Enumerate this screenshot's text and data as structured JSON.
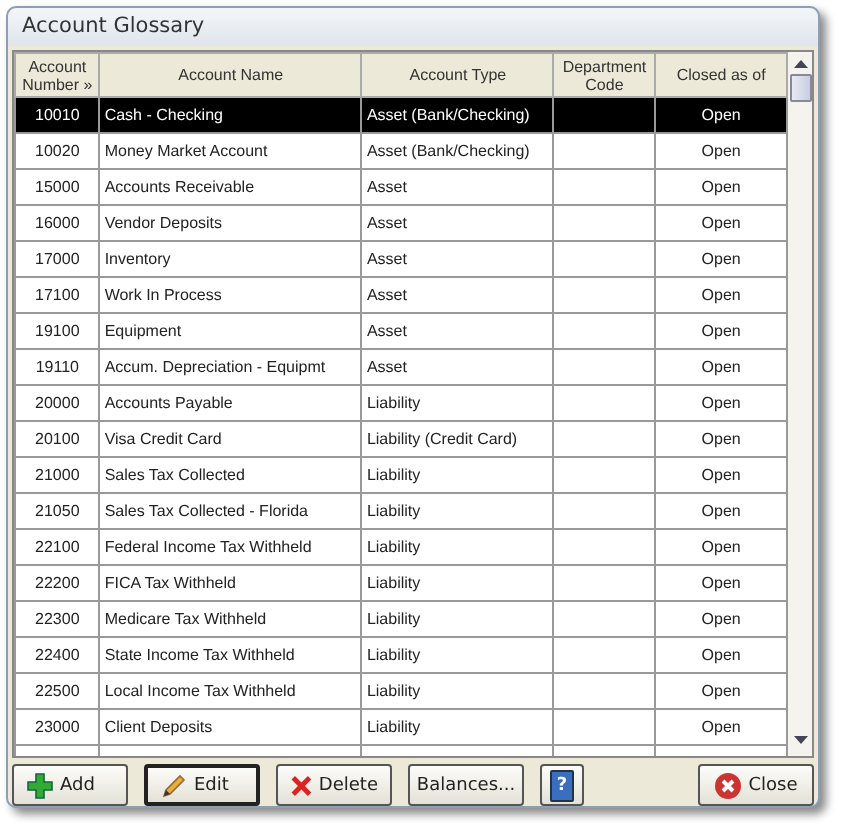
{
  "window": {
    "title": "Account Glossary"
  },
  "table": {
    "columns": [
      "Account Number »",
      "Account Name",
      "Account Type",
      "Department Code",
      "Closed as of"
    ],
    "rows": [
      {
        "cells": [
          "10010",
          "Cash - Checking",
          "Asset (Bank/Checking)",
          "",
          "Open"
        ],
        "selected": true
      },
      {
        "cells": [
          "10020",
          "Money Market Account",
          "Asset (Bank/Checking)",
          "",
          "Open"
        ],
        "selected": false
      },
      {
        "cells": [
          "15000",
          "Accounts Receivable",
          "Asset",
          "",
          "Open"
        ],
        "selected": false
      },
      {
        "cells": [
          "16000",
          "Vendor Deposits",
          "Asset",
          "",
          "Open"
        ],
        "selected": false
      },
      {
        "cells": [
          "17000",
          "Inventory",
          "Asset",
          "",
          "Open"
        ],
        "selected": false
      },
      {
        "cells": [
          "17100",
          "Work In Process",
          "Asset",
          "",
          "Open"
        ],
        "selected": false
      },
      {
        "cells": [
          "19100",
          "Equipment",
          "Asset",
          "",
          "Open"
        ],
        "selected": false
      },
      {
        "cells": [
          "19110",
          "Accum. Depreciation - Equipmt",
          "Asset",
          "",
          "Open"
        ],
        "selected": false
      },
      {
        "cells": [
          "20000",
          "Accounts Payable",
          "Liability",
          "",
          "Open"
        ],
        "selected": false
      },
      {
        "cells": [
          "20100",
          "Visa Credit Card",
          "Liability (Credit Card)",
          "",
          "Open"
        ],
        "selected": false
      },
      {
        "cells": [
          "21000",
          "Sales Tax Collected",
          "Liability",
          "",
          "Open"
        ],
        "selected": false
      },
      {
        "cells": [
          "21050",
          "Sales Tax Collected - Florida",
          "Liability",
          "",
          "Open"
        ],
        "selected": false
      },
      {
        "cells": [
          "22100",
          "Federal Income Tax Withheld",
          "Liability",
          "",
          "Open"
        ],
        "selected": false
      },
      {
        "cells": [
          "22200",
          "FICA Tax Withheld",
          "Liability",
          "",
          "Open"
        ],
        "selected": false
      },
      {
        "cells": [
          "22300",
          "Medicare Tax Withheld",
          "Liability",
          "",
          "Open"
        ],
        "selected": false
      },
      {
        "cells": [
          "22400",
          "State Income Tax Withheld",
          "Liability",
          "",
          "Open"
        ],
        "selected": false
      },
      {
        "cells": [
          "22500",
          "Local Income Tax Withheld",
          "Liability",
          "",
          "Open"
        ],
        "selected": false
      },
      {
        "cells": [
          "23000",
          "Client Deposits",
          "Liability",
          "",
          "Open"
        ],
        "selected": false
      }
    ]
  },
  "buttons": [
    {
      "kind": "add",
      "label": "Add"
    },
    {
      "kind": "edit",
      "label": "Edit"
    },
    {
      "kind": "delete",
      "label": "Delete"
    },
    {
      "kind": "plain",
      "label": "Balances..."
    },
    {
      "kind": "help",
      "label": "?"
    },
    {
      "kind": "close",
      "label": "Close"
    }
  ]
}
